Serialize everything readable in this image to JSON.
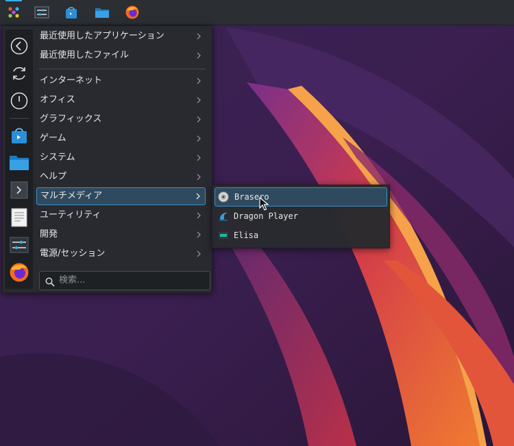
{
  "panel": {
    "launchers": [
      {
        "icon": "application-launcher-icon",
        "active": true
      },
      {
        "icon": "system-settings-icon"
      },
      {
        "icon": "discover-store-icon"
      },
      {
        "icon": "file-manager-icon"
      },
      {
        "icon": "firefox-icon"
      }
    ]
  },
  "favorites": [
    {
      "icon": "back-icon"
    },
    {
      "icon": "restart-icon"
    },
    {
      "icon": "power-icon"
    },
    {
      "icon": "discover-store-icon"
    },
    {
      "icon": "folder-icon"
    },
    {
      "icon": "terminal-icon"
    },
    {
      "icon": "text-editor-icon"
    },
    {
      "icon": "system-settings-icon"
    },
    {
      "icon": "firefox-icon"
    }
  ],
  "menu": {
    "categories": [
      {
        "label": "最近使用したアプリケーション"
      },
      {
        "label": "最近使用したファイル"
      },
      {
        "label": "インターネット"
      },
      {
        "label": "オフィス"
      },
      {
        "label": "グラフィックス"
      },
      {
        "label": "ゲーム"
      },
      {
        "label": "システム"
      },
      {
        "label": "ヘルプ"
      },
      {
        "label": "マルチメディア",
        "highlighted": true
      },
      {
        "label": "ユーティリティ"
      },
      {
        "label": "開発"
      },
      {
        "label": "電源/セッション"
      }
    ],
    "search_placeholder": "検索..."
  },
  "submenu": {
    "items": [
      {
        "label": "Brasero",
        "icon": "brasero-icon",
        "highlighted": true
      },
      {
        "label": "Dragon Player",
        "icon": "dragon-player-icon"
      },
      {
        "label": "Elisa",
        "icon": "elisa-icon"
      }
    ]
  },
  "colors": {
    "accent": "#3daee9",
    "highlight_bg": "#2f4a5f",
    "menu_bg": "#282a2e",
    "panel_bg": "#2b2e33"
  }
}
